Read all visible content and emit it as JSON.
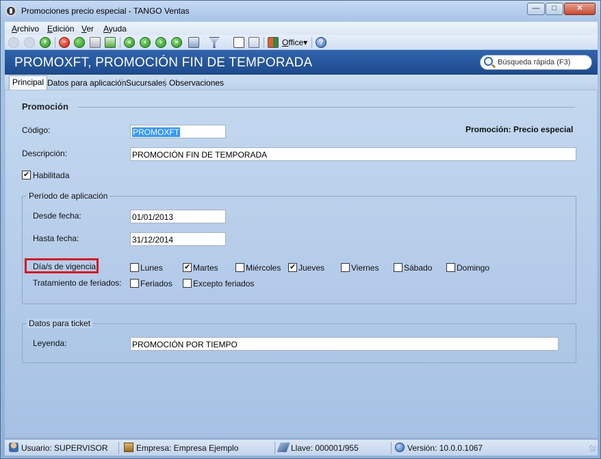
{
  "window": {
    "title": "Promociones precio especial - TANGO Ventas",
    "min_glyph": "—",
    "max_glyph": "□",
    "close_glyph": "✕"
  },
  "menu": {
    "archivo": {
      "u": "A",
      "rest": "rchivo"
    },
    "edicion": {
      "u": "E",
      "rest": "dición"
    },
    "ver": {
      "u": "V",
      "rest": "er"
    },
    "ayuda": {
      "u": "A",
      "rest": "yuda"
    }
  },
  "toolbar": {
    "office_u": "O",
    "office_rest": "ffice",
    "office_arrow": "▾",
    "help_glyph": "?"
  },
  "header": {
    "record_title": "PROMOXFT, PROMOCIÓN FIN DE TEMPORADA",
    "search_placeholder": "Búsqueda rápida (F3)"
  },
  "tabs": [
    "Principal",
    "Datos para aplicación",
    "Sucursales",
    "Observaciones"
  ],
  "form": {
    "section_title": "Promoción",
    "codigo_label": "Código:",
    "codigo_value": "PROMOXFT",
    "promo_type": "Promoción: Precio especial",
    "descripcion_label": "Descripción:",
    "descripcion_value": "PROMOCIÓN FIN DE TEMPORADA",
    "habilitada_label": "Habilitada",
    "habilitada_checked": true,
    "periodo": {
      "title": "Período de aplicación",
      "desde_label": "Desde fecha:",
      "desde_value": "01/01/2013",
      "hasta_label": "Hasta fecha:",
      "hasta_value": "31/12/2014",
      "dias_label": "Día/s de vigencia:",
      "dias": [
        {
          "label": "Lunes",
          "checked": false
        },
        {
          "label": "Martes",
          "checked": true
        },
        {
          "label": "Miércoles",
          "checked": false
        },
        {
          "label": "Jueves",
          "checked": true
        },
        {
          "label": "Viernes",
          "checked": false
        },
        {
          "label": "Sábado",
          "checked": false
        },
        {
          "label": "Domingo",
          "checked": false
        }
      ],
      "feriados_label": "Tratamiento de feriados:",
      "feriados": [
        {
          "label": "Feriados",
          "checked": false
        },
        {
          "label": "Excepto feriados",
          "checked": false
        }
      ]
    },
    "ticket": {
      "title": "Datos para ticket",
      "leyenda_label": "Leyenda:",
      "leyenda_value": "PROMOCIÓN POR TIEMPO"
    }
  },
  "status": {
    "usuario": "Usuario: SUPERVISOR",
    "empresa": "Empresa: Empresa Ejemplo",
    "llave": "Llave: 000001/955",
    "version": "Versión: 10.0.0.1067"
  },
  "colors": {
    "header_band": "#2f64ad",
    "highlight": "#e0141c",
    "selection": "#3399ff"
  }
}
